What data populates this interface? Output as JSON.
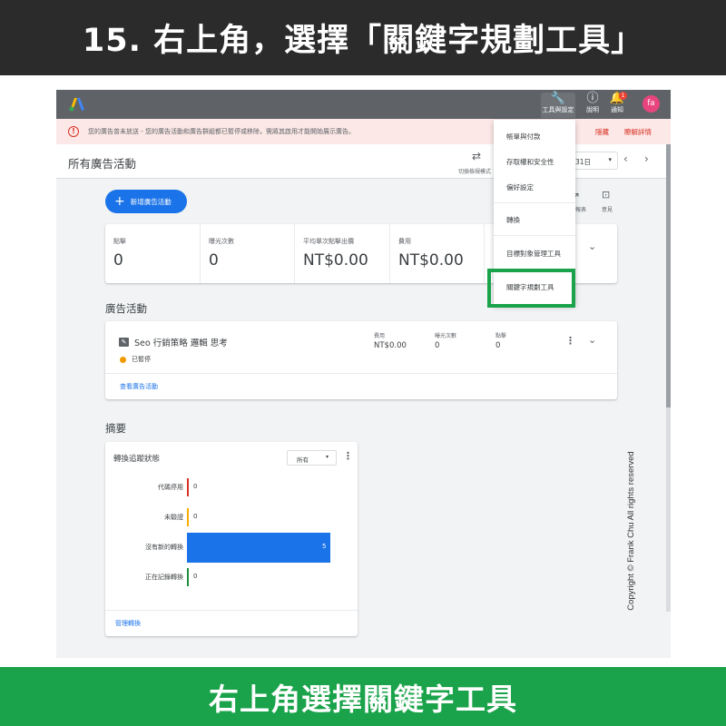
{
  "banner": {
    "top_title": "15. 右上角，選擇「關鍵字規劃工具」",
    "bottom_caption": "右上角選擇關鍵字工具",
    "copyright": "Copyright © Frank Chu All rights reserved"
  },
  "app_bar": {
    "tools_icon": "wrench-icon",
    "tools_label": "工具與設定",
    "help_label": "說明",
    "notifications_label": "通知",
    "notification_count": "1",
    "avatar_initials": "fa"
  },
  "alert": {
    "message": "您的廣告曾未放送 - 您的廣告活動和廣告群組都已暫停或移除，需將其啟用才能開始展示廣告。",
    "hide_label": "隱藏",
    "details_label": "瞭解詳情"
  },
  "header": {
    "title": "所有廣告活動",
    "switch_label": "切換檢視模式",
    "date_value": "31日"
  },
  "toolbar": {
    "new_campaign_label": "新增廣告活動",
    "side_label_1": "報表",
    "side_label_2": "意見"
  },
  "metrics": [
    {
      "label": "點擊",
      "value": "0"
    },
    {
      "label": "曝光次數",
      "value": "0"
    },
    {
      "label": "平均單次點擊出價",
      "value": "NT$0.00"
    },
    {
      "label": "費用",
      "value": "NT$0.00"
    }
  ],
  "campaigns_section": {
    "title": "廣告活動",
    "campaign_name": "Seo 行銷策略 邏輯 思考",
    "status": "已暫停",
    "stats": [
      {
        "label": "費用",
        "value": "NT$0.00"
      },
      {
        "label": "曝光次數",
        "value": "0"
      },
      {
        "label": "點擊",
        "value": "0"
      }
    ],
    "view_link": "查看廣告活動"
  },
  "summary_section": {
    "title": "摘要",
    "card_title": "轉換追蹤狀態",
    "select_value": "所有",
    "manage_link": "管理轉換"
  },
  "chart_data": {
    "type": "bar",
    "orientation": "horizontal",
    "categories": [
      "代碼停用",
      "未驗證",
      "沒有新的轉換",
      "正在記錄轉換"
    ],
    "values": [
      0,
      0,
      5,
      0
    ],
    "colors": [
      "#d93025",
      "#f9ab00",
      "#1a73e8",
      "#1e8e3e"
    ],
    "xlim": [
      0,
      5
    ]
  },
  "dropdown": {
    "items": [
      "帳單與付款",
      "存取權和安全性",
      "偏好設定",
      "轉換",
      "目標對象管理工具",
      "關鍵字規劃工具"
    ]
  },
  "colors": {
    "highlight": "#1aa34a",
    "primary": "#1a73e8",
    "banner_dark": "#2b2b2b"
  }
}
